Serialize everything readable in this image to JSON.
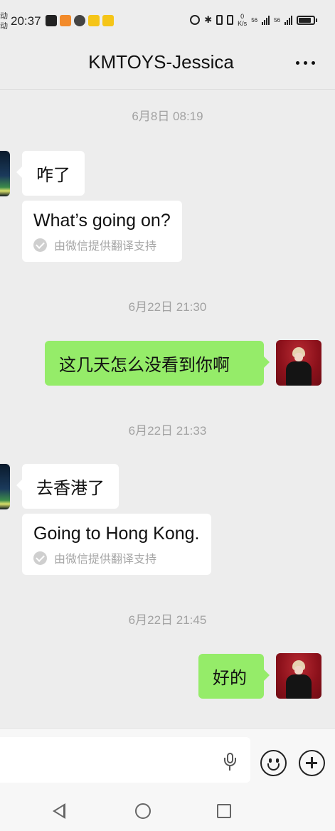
{
  "status_bar": {
    "auto_label": "动动",
    "time": "20:37",
    "net_speed": "0\nK/s",
    "signal_1": "56",
    "signal_2": "56"
  },
  "header": {
    "title": "KMTOYS-Jessica",
    "more_icon": "more-dots-icon"
  },
  "messages": [
    {
      "type": "timestamp",
      "text": "6月8日 08:19"
    },
    {
      "type": "incoming",
      "text": "咋了"
    },
    {
      "type": "translation",
      "text": "What’s going on?",
      "note": "由微信提供翻译支持"
    },
    {
      "type": "timestamp",
      "text": "6月22日 21:30"
    },
    {
      "type": "outgoing",
      "text": "这几天怎么没看到你啊"
    },
    {
      "type": "timestamp",
      "text": "6月22日 21:33"
    },
    {
      "type": "incoming",
      "text": "去香港了"
    },
    {
      "type": "translation",
      "text": "Going to Hong Kong.",
      "note": "由微信提供翻译支持"
    },
    {
      "type": "timestamp",
      "text": "6月22日 21:45"
    },
    {
      "type": "outgoing",
      "text": "好的"
    }
  ],
  "input_bar": {
    "input_value": "",
    "voice_icon": "microphone-icon",
    "emoji_icon": "smiley-icon",
    "plus_icon": "plus-circle-icon"
  },
  "nav_bar": {
    "back_icon": "triangle-back-icon",
    "home_icon": "circle-home-icon",
    "recents_icon": "square-recents-icon"
  },
  "colors": {
    "chat_bg": "#ededed",
    "outgoing_bubble": "#95ec69",
    "incoming_bubble": "#ffffff",
    "timestamp": "#a2a2a2"
  }
}
